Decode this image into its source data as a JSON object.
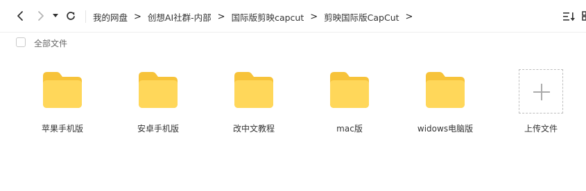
{
  "toolbar": {
    "back_icon": "chevron-left-icon",
    "forward_icon": "chevron-right-icon",
    "history_icon": "caret-down-icon",
    "refresh_icon": "refresh-icon",
    "sort_icon": "sort-list-icon",
    "breadcrumb": [
      "我的网盘",
      "创想AI社群-内部",
      "国际版剪映capcut",
      "剪映国际版CapCut"
    ],
    "breadcrumb_separator": ">"
  },
  "select_bar": {
    "label": "全部文件",
    "checked": false
  },
  "items": [
    {
      "type": "folder",
      "name": "苹果手机版"
    },
    {
      "type": "folder",
      "name": "安卓手机版"
    },
    {
      "type": "folder",
      "name": "改中文教程"
    },
    {
      "type": "folder",
      "name": "mac版"
    },
    {
      "type": "folder",
      "name": "widows电脑版"
    },
    {
      "type": "upload",
      "name": "上传文件"
    }
  ],
  "colors": {
    "folder_back": "#f7c33a",
    "folder_front": "#ffd75a",
    "text": "#333333",
    "muted": "#666666"
  }
}
